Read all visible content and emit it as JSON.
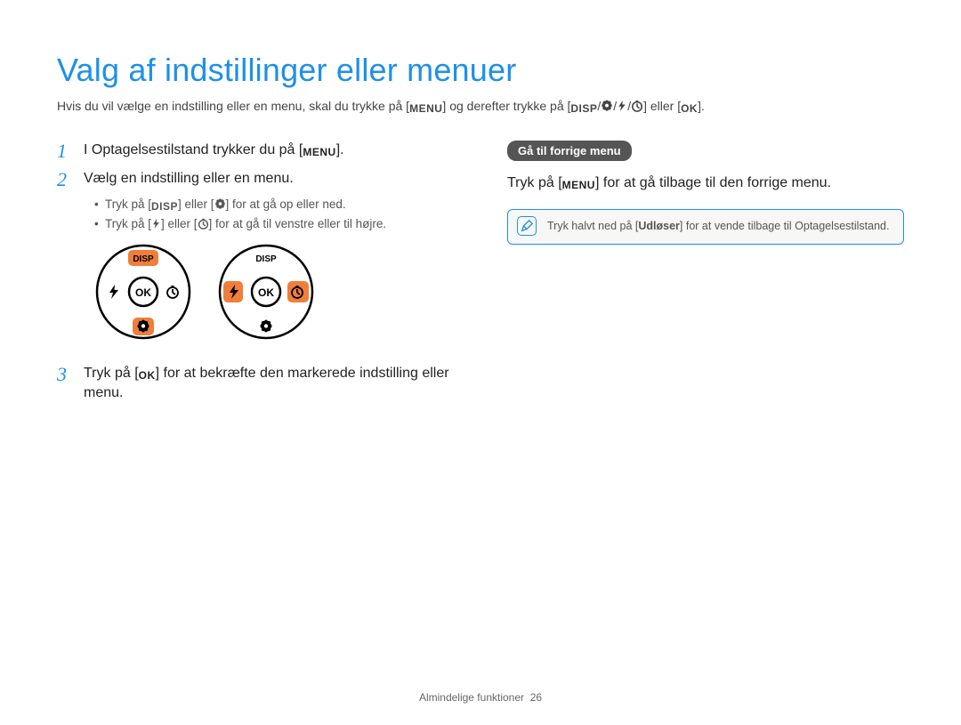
{
  "title": "Valg af indstillinger eller menuer",
  "intro": {
    "p1": "Hvis du vil vælge en indstilling eller en menu, skal du trykke på [",
    "p2": "] og derefter trykke på [",
    "p3": "] eller [",
    "p4": "]."
  },
  "glyphs": {
    "menu": "MENU",
    "disp": "DISP",
    "ok": "OK"
  },
  "steps": {
    "s1_a": "I Optagelsestilstand trykker du på [",
    "s1_b": "].",
    "s2": "Vælg en indstilling eller en menu.",
    "s2_b1_a": "Tryk på [",
    "s2_b1_b": "] eller [",
    "s2_b1_c": "] for at gå op eller ned.",
    "s2_b2_a": "Tryk på [",
    "s2_b2_b": "] eller [",
    "s2_b2_c": "] for at gå til venstre eller til højre.",
    "s3_a": "Tryk på [",
    "s3_b": "] for at bekræfte den markerede indstilling eller menu."
  },
  "dial": {
    "disp": "DISP",
    "ok": "OK"
  },
  "right": {
    "pill": "Gå til forrige menu",
    "para_a": "Tryk på [",
    "para_b": "] for at gå tilbage til den forrige menu.",
    "note_a": "Tryk halvt ned på [",
    "note_bold": "Udløser",
    "note_b": "] for at vende tilbage til Optagelsestilstand."
  },
  "footer": {
    "section": "Almindelige funktioner",
    "page": "26"
  }
}
